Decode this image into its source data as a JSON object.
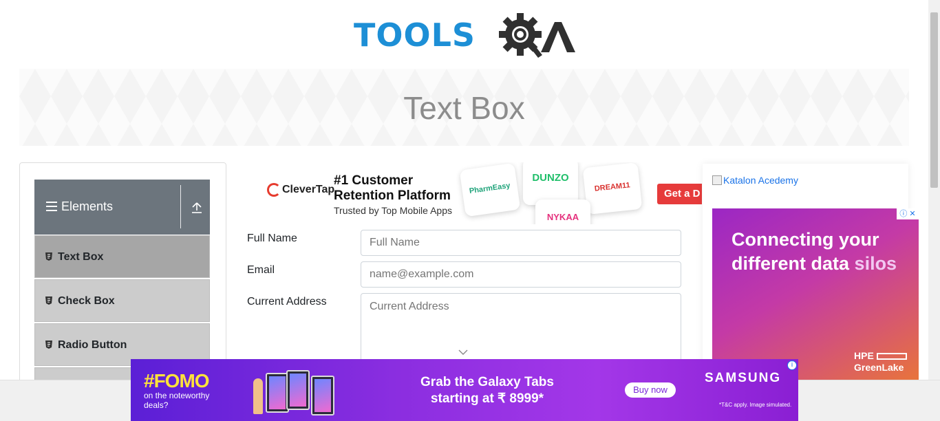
{
  "logo": {
    "tools_text": "TOOLS",
    "qa_text": "QA",
    "brand_color": "#1d8fd6"
  },
  "banner": {
    "title": "Text Box"
  },
  "sidebar": {
    "group_title": "Elements",
    "items": [
      {
        "label": "Text Box",
        "active": true
      },
      {
        "label": "Check Box",
        "active": false
      },
      {
        "label": "Radio Button",
        "active": false
      }
    ]
  },
  "ad_top": {
    "brand": "CleverTap",
    "headline": "#1 Customer Retention Platform",
    "subline": "Trusted by Top Mobile Apps",
    "cards": [
      "PharmEasy",
      "DUNZO",
      "DREAM11",
      "NYKAA"
    ],
    "cta": "Get a D"
  },
  "form": {
    "full_name": {
      "label": "Full Name",
      "placeholder": "Full Name",
      "value": ""
    },
    "email": {
      "label": "Email",
      "placeholder": "name@example.com",
      "value": ""
    },
    "current_address": {
      "label": "Current Address",
      "placeholder": "Current Address",
      "value": ""
    }
  },
  "right_ads": {
    "katalon_alt": "Katalon Acedemy",
    "hpe_line1": "Connecting your",
    "hpe_line2": "different data",
    "hpe_line2_highlight": "silos",
    "hpe_brand_line1": "HPE",
    "hpe_brand_line2": "GreenLake"
  },
  "bottom_ad": {
    "fomo": "#FOMO",
    "fomo_sub": "on the noteworthy deals?",
    "headline_line1": "Grab the Galaxy Tabs",
    "headline_line2": "starting at ₹ 8999*",
    "cta": "Buy now",
    "brand": "SAMSUNG",
    "disclaimer": "*T&C apply. Image simulated."
  },
  "colors": {
    "sidebar_header": "#6c757d",
    "menu_active": "#a6a6a6",
    "menu_item": "#cccccc",
    "accent_red": "#e63b3b",
    "samsung_purple": "#8b2ee0"
  }
}
